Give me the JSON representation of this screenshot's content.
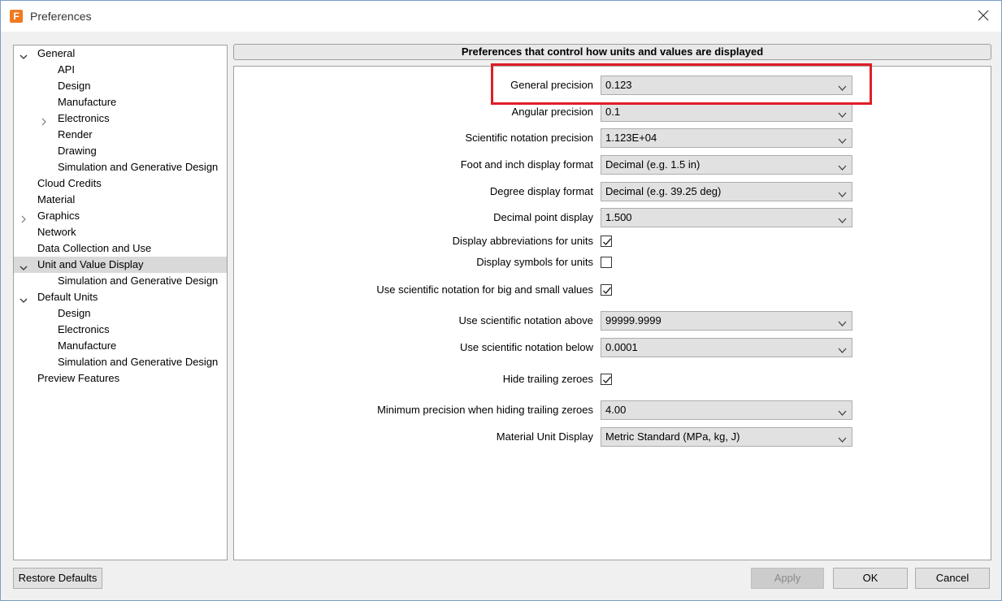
{
  "window": {
    "title": "Preferences",
    "app_icon_letter": "F"
  },
  "tree": [
    {
      "label": "General",
      "twisty": "expanded"
    },
    {
      "label": "API",
      "twisty": "none"
    },
    {
      "label": "Design",
      "twisty": "none"
    },
    {
      "label": "Manufacture",
      "twisty": "none"
    },
    {
      "label": "Electronics",
      "twisty": "collapsed"
    },
    {
      "label": "Render",
      "twisty": "none"
    },
    {
      "label": "Drawing",
      "twisty": "none"
    },
    {
      "label": "Simulation and Generative Design",
      "twisty": "none"
    },
    {
      "label": "Cloud Credits",
      "twisty": "none"
    },
    {
      "label": "Material",
      "twisty": "none"
    },
    {
      "label": "Graphics",
      "twisty": "collapsed"
    },
    {
      "label": "Network",
      "twisty": "none"
    },
    {
      "label": "Data Collection and Use",
      "twisty": "none"
    },
    {
      "label": "Unit and Value Display",
      "twisty": "expanded",
      "selected": true
    },
    {
      "label": "Simulation and Generative Design",
      "twisty": "none"
    },
    {
      "label": "Default Units",
      "twisty": "expanded"
    },
    {
      "label": "Design",
      "twisty": "none"
    },
    {
      "label": "Electronics",
      "twisty": "none"
    },
    {
      "label": "Manufacture",
      "twisty": "none"
    },
    {
      "label": "Simulation and Generative Design",
      "twisty": "none"
    },
    {
      "label": "Preview Features",
      "twisty": "none"
    }
  ],
  "panel": {
    "header": "Preferences that control how units and values are displayed",
    "settings": [
      {
        "label": "General precision",
        "type": "dropdown",
        "value": "0.123"
      },
      {
        "label": "Angular precision",
        "type": "dropdown",
        "value": "0.1"
      },
      {
        "label": "Scientific notation precision",
        "type": "dropdown",
        "value": "1.123E+04"
      },
      {
        "label": "Foot and inch display format",
        "type": "dropdown",
        "value": "Decimal (e.g. 1.5 in)"
      },
      {
        "label": "Degree display format",
        "type": "dropdown",
        "value": "Decimal (e.g. 39.25 deg)"
      },
      {
        "label": "Decimal point display",
        "type": "dropdown",
        "value": "1.500"
      },
      {
        "label": "Display abbreviations for units",
        "type": "checkbox",
        "checked": true
      },
      {
        "label": "Display symbols for units",
        "type": "checkbox",
        "checked": false
      },
      {
        "label": "Use scientific notation for big and small values",
        "type": "checkbox",
        "checked": true
      },
      {
        "label": "Use scientific notation above",
        "type": "dropdown",
        "value": "99999.9999"
      },
      {
        "label": "Use scientific notation below",
        "type": "dropdown",
        "value": "0.0001"
      },
      {
        "label": "Hide trailing zeroes",
        "type": "checkbox",
        "checked": true
      },
      {
        "label": "Minimum precision when hiding trailing zeroes",
        "type": "dropdown",
        "value": "4.00"
      },
      {
        "label": "Material Unit Display",
        "type": "dropdown",
        "value": "Metric Standard (MPa, kg, J)"
      }
    ]
  },
  "footer": {
    "restore_defaults": "Restore Defaults",
    "apply": "Apply",
    "ok": "OK",
    "cancel": "Cancel"
  },
  "colors": {
    "highlight": "#e01e26",
    "selection": "#d9d9d9"
  }
}
